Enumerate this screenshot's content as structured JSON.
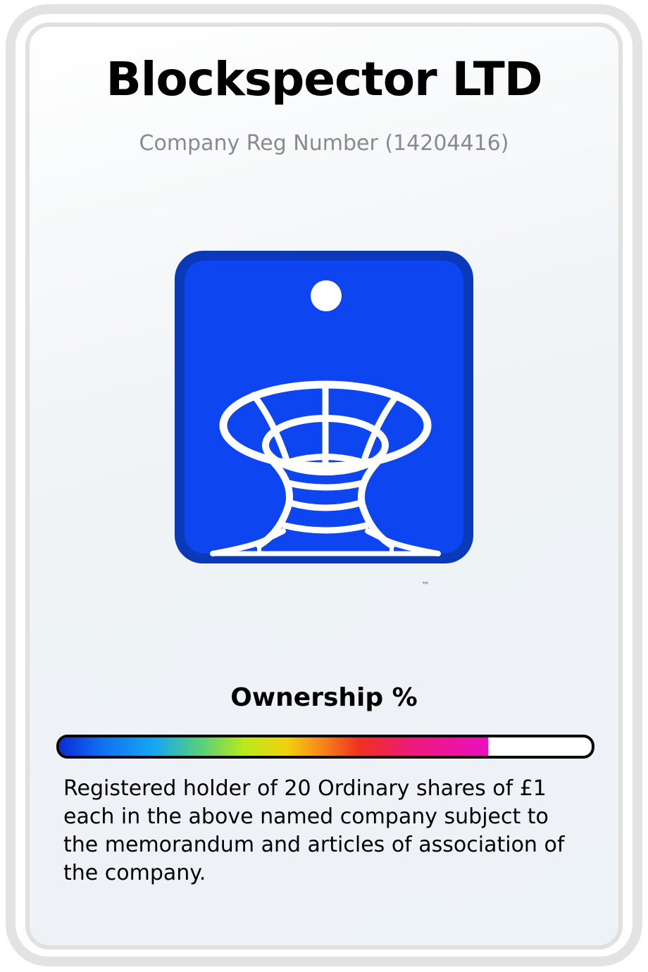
{
  "certificate": {
    "company_name": "Blockspector LTD",
    "reg_number_text": "Company Reg Number (14204416)",
    "trademark": "™",
    "logo_icon": "blockspector-logo-icon",
    "brand_color": "#0d45f0",
    "ownership_label": "Ownership %",
    "ownership_fill_percent": 80.5,
    "description": "Registered holder of 20 Ordinary shares of £1 each in the above named company subject to the memorandum and articles of association of the company."
  }
}
